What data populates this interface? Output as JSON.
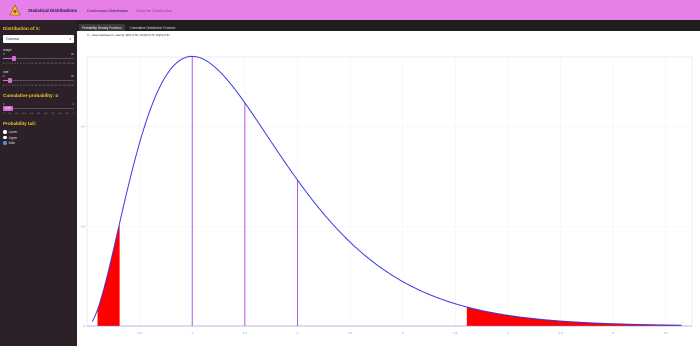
{
  "app": {
    "title": "Statistical Distributions",
    "nav": [
      "Continuous Distribution",
      "Discrete Distribution"
    ]
  },
  "sidebar": {
    "dist_heading": "Distribution of X:",
    "dist_selected": "Gamma",
    "shape": {
      "label": "shape",
      "min": "0",
      "max": "20",
      "value": 3,
      "range": [
        0,
        20
      ],
      "ticks": [
        "0",
        "1",
        "2",
        "3",
        "4",
        "5",
        "6",
        "7",
        "8",
        "9",
        "10",
        "11",
        "12",
        "13",
        "14",
        "15",
        "16",
        "17",
        "18",
        "19",
        "20"
      ]
    },
    "rate": {
      "label": "rate",
      "min": "0",
      "max": "20",
      "value": 2,
      "range": [
        0,
        20
      ],
      "ticks": [
        "0",
        "1",
        "2",
        "3",
        "4",
        "5",
        "6",
        "7",
        "8",
        "9",
        "10",
        "11",
        "12",
        "13",
        "14",
        "15",
        "16",
        "17",
        "18",
        "19",
        "20"
      ]
    },
    "cum_heading": "Cumulative probability: α",
    "alpha": {
      "min": "0",
      "max": "1",
      "value": 0.05,
      "range": [
        0,
        1
      ],
      "label": "0.05",
      "ticks": [
        "0",
        "0.1",
        "0.2",
        "0.3",
        "0.4",
        "0.5",
        "0.6",
        "0.7",
        "0.8",
        "0.9",
        "1"
      ]
    },
    "tail_heading": "Probability tail:",
    "tails": [
      {
        "label": "Lower",
        "selected": false
      },
      {
        "label": "Upper",
        "selected": false
      },
      {
        "label": "Both",
        "selected": true
      }
    ]
  },
  "tabs": [
    "Probability Density Function",
    "Cumulative Distribution Function"
  ],
  "subtitle": "X ~ Gamma(shape=3, rate=2): E[X]=1.50, Var[X]=0.75, Sd[X]=0.87",
  "chart_data": {
    "type": "area",
    "distribution": "Gamma",
    "shape": 3,
    "rate": 2,
    "tail": "both",
    "alpha": 0.05,
    "lower_quantile": 0.31,
    "upper_quantile": 3.61,
    "vlines": [
      1.0,
      1.5,
      2.0
    ],
    "x_ticks": [
      "0.5",
      "1",
      "1.5",
      "2",
      "2.5",
      "3",
      "3.5",
      "4",
      "4.5",
      "5",
      "5.5"
    ],
    "y_ticks": [
      "0",
      "0.2",
      "0.4"
    ],
    "colors": {
      "curve": "#3a3ae0",
      "tail_fill": "#ff0000",
      "vline": "#b040e0"
    }
  }
}
